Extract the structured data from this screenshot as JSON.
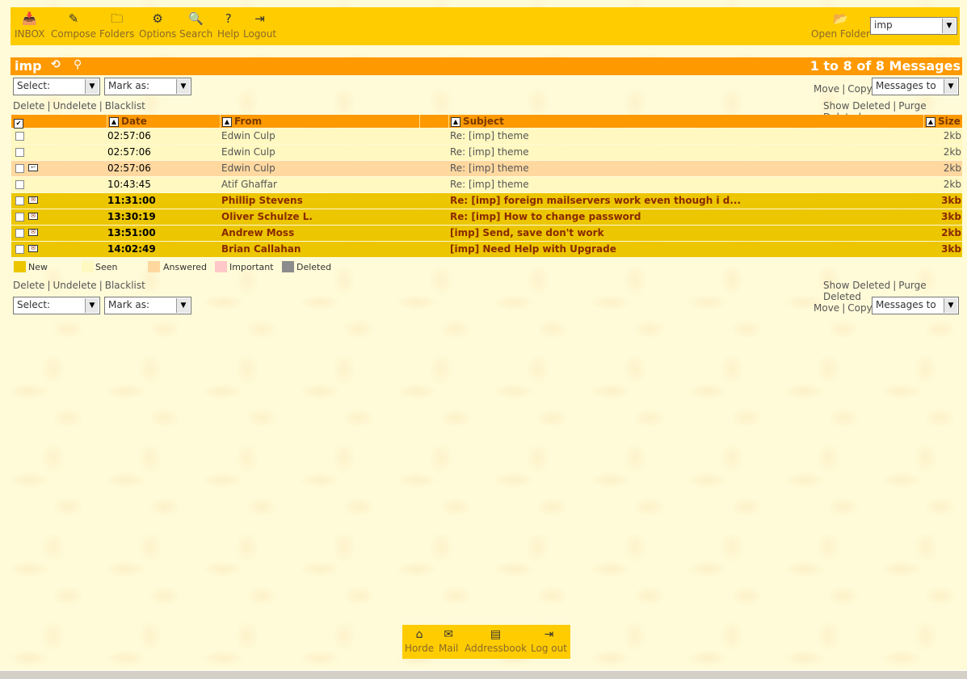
{
  "toolbar": {
    "items": [
      {
        "label": "INBOX",
        "icon": "inbox-icon"
      },
      {
        "label": "Compose",
        "icon": "compose-icon"
      },
      {
        "label": "Folders",
        "icon": "folders-icon"
      },
      {
        "label": "Options",
        "icon": "options-icon"
      },
      {
        "label": "Search",
        "icon": "search-icon"
      },
      {
        "label": "Help",
        "icon": "help-icon"
      },
      {
        "label": "Logout",
        "icon": "logout-icon"
      }
    ],
    "open_folder_label": "Open Folder",
    "folder_value": "imp"
  },
  "header": {
    "folder_name": "imp",
    "message_range": "1 to 8 of 8 Messages"
  },
  "controls": {
    "select_label": "Select:",
    "mark_as_label": "Mark as:",
    "move": "Move",
    "copy": "Copy",
    "messages_to": "Messages to",
    "delete": "Delete",
    "undelete": "Undelete",
    "blacklist": "Blacklist",
    "show_deleted": "Show Deleted",
    "purge_deleted": "Purge Deleted"
  },
  "columns": {
    "date": "Date",
    "from": "From",
    "subject": "Subject",
    "size": "Size"
  },
  "messages": [
    {
      "date": "02:57:06",
      "from": "Edwin Culp",
      "subject": "Re: [imp] theme",
      "size": "2kb",
      "status": "seen"
    },
    {
      "date": "02:57:06",
      "from": "Edwin Culp",
      "subject": "Re: [imp] theme",
      "size": "2kb",
      "status": "seen"
    },
    {
      "date": "02:57:06",
      "from": "Edwin Culp",
      "subject": "Re: [imp] theme",
      "size": "2kb",
      "status": "answered"
    },
    {
      "date": "10:43:45",
      "from": "Atif Ghaffar",
      "subject": "Re: [imp] theme",
      "size": "2kb",
      "status": "seen"
    },
    {
      "date": "11:31:00",
      "from": "Phillip Stevens",
      "subject": "Re: [imp] foreign mailservers work even though i d...",
      "size": "3kb",
      "status": "new"
    },
    {
      "date": "13:30:19",
      "from": "Oliver Schulze L.",
      "subject": "Re: [imp] How to change password",
      "size": "3kb",
      "status": "new"
    },
    {
      "date": "13:51:00",
      "from": "Andrew Moss",
      "subject": "[imp] Send, save don't work",
      "size": "2kb",
      "status": "new"
    },
    {
      "date": "14:02:49",
      "from": "Brian Callahan",
      "subject": "[imp] Need Help with Upgrade",
      "size": "3kb",
      "status": "new"
    }
  ],
  "legend": [
    {
      "label": "New",
      "color": "#ecc600"
    },
    {
      "label": "Seen",
      "color": "#fff8c0"
    },
    {
      "label": "Answered",
      "color": "#ffd8a0"
    },
    {
      "label": "Important",
      "color": "#ffc8c8"
    },
    {
      "label": "Deleted",
      "color": "#8c8c8c"
    }
  ],
  "bottom_nav": [
    {
      "label": "Horde",
      "icon": "home-icon"
    },
    {
      "label": "Mail",
      "icon": "mail-icon"
    },
    {
      "label": "Addressbook",
      "icon": "addressbook-icon"
    },
    {
      "label": "Log out",
      "icon": "logout-icon"
    }
  ]
}
